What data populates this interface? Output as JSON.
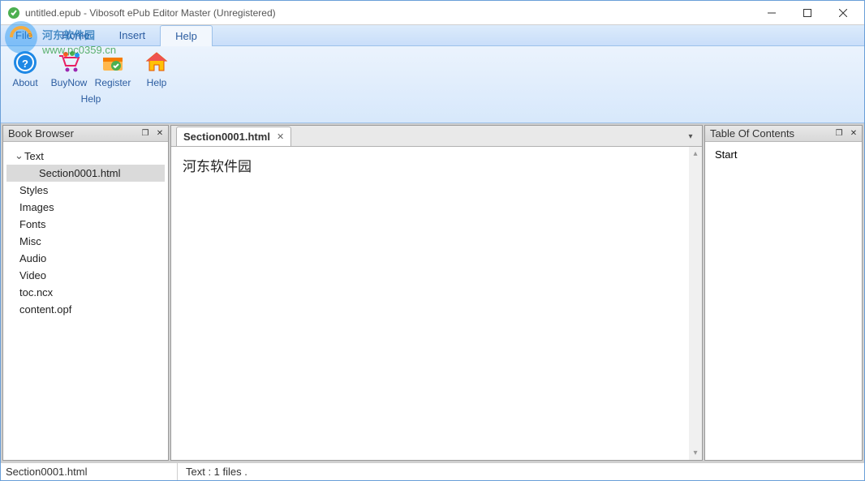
{
  "title": "untitled.epub - Vibosoft ePub Editor Master (Unregistered)",
  "menus": {
    "file": "File",
    "home": "Home",
    "insert": "Insert",
    "help": "Help"
  },
  "ribbon": {
    "group_label": "Help",
    "buttons": {
      "about": "About",
      "buynow": "BuyNow",
      "register": "Register",
      "help": "Help"
    }
  },
  "panels": {
    "book_browser": {
      "title": "Book Browser",
      "tree": {
        "text": "Text",
        "section": "Section0001.html",
        "styles": "Styles",
        "images": "Images",
        "fonts": "Fonts",
        "misc": "Misc",
        "audio": "Audio",
        "video": "Video",
        "tocncx": "toc.ncx",
        "contentopf": "content.opf"
      }
    },
    "toc": {
      "title": "Table Of Contents",
      "start": "Start"
    }
  },
  "editor": {
    "tab_label": "Section0001.html",
    "content": "河东软件园"
  },
  "status": {
    "left": "Section0001.html",
    "right": "Text : 1 files ."
  },
  "watermark": {
    "line1": "河东软件园",
    "line2": "www.pc0359.cn"
  }
}
